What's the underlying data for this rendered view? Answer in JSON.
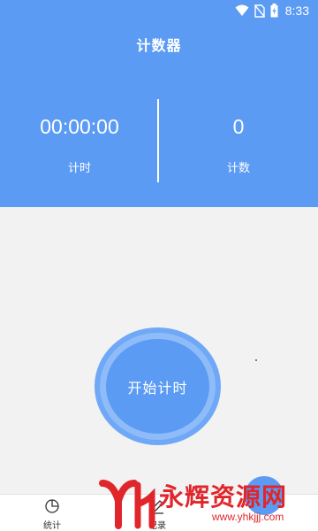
{
  "status_bar": {
    "time": "8:33",
    "icons": [
      "wifi-icon",
      "no-sim-icon",
      "battery-charging-icon"
    ]
  },
  "header": {
    "title": "计数器"
  },
  "metrics": {
    "timer_value": "00:00:00",
    "timer_label": "计时",
    "count_value": "0",
    "count_label": "计数"
  },
  "main": {
    "start_button_label": "开始计时"
  },
  "bottom_nav": {
    "items": [
      {
        "label": "统计",
        "icon": "pie-chart-icon"
      },
      {
        "label": "记录",
        "icon": "edit-icon"
      }
    ]
  },
  "watermark": {
    "text": "永辉资源网",
    "url": "www.yhkjjj.com"
  },
  "colors": {
    "primary": "#5b9bf3",
    "background": "#f2f2f2",
    "watermark": "#e0262b"
  }
}
